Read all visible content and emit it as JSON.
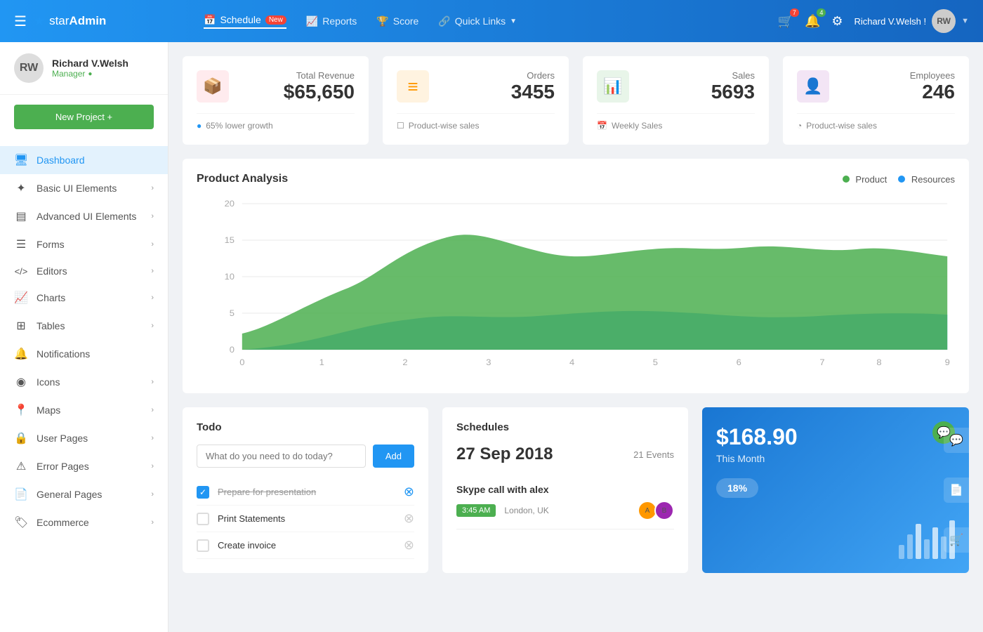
{
  "brand": {
    "name_part1": "star",
    "name_part2": "Admin"
  },
  "topnav": {
    "hamburger": "☰",
    "links": [
      {
        "label": "Schedule",
        "badge": "New",
        "icon": "📅"
      },
      {
        "label": "Reports",
        "icon": "📈"
      },
      {
        "label": "Score",
        "icon": "🏆"
      },
      {
        "label": "Quick Links",
        "icon": "🔗",
        "has_arrow": true
      }
    ],
    "notifications_count": "7",
    "alerts_count": "4",
    "user_name": "Richard V.Welsh !",
    "user_initials": "RW"
  },
  "sidebar": {
    "user_name": "Richard V.Welsh",
    "user_role": "Manager",
    "new_project_label": "New Project +",
    "items": [
      {
        "id": "dashboard",
        "label": "Dashboard",
        "icon": "🖥",
        "active": true,
        "has_arrow": false
      },
      {
        "id": "basic-ui",
        "label": "Basic UI Elements",
        "icon": "✦",
        "has_arrow": true
      },
      {
        "id": "advanced-ui",
        "label": "Advanced UI Elements",
        "icon": "▤",
        "has_arrow": true
      },
      {
        "id": "forms",
        "label": "Forms",
        "icon": "☰",
        "has_arrow": true
      },
      {
        "id": "editors",
        "label": "Editors",
        "icon": "<>",
        "has_arrow": true
      },
      {
        "id": "charts",
        "label": "Charts",
        "icon": "📈",
        "has_arrow": true
      },
      {
        "id": "tables",
        "label": "Tables",
        "icon": "⊞",
        "has_arrow": true
      },
      {
        "id": "notifications",
        "label": "Notifications",
        "icon": "🔔",
        "has_arrow": false
      },
      {
        "id": "icons",
        "label": "Icons",
        "icon": "◉",
        "has_arrow": true
      },
      {
        "id": "maps",
        "label": "Maps",
        "icon": "📍",
        "has_arrow": true
      },
      {
        "id": "user-pages",
        "label": "User Pages",
        "icon": "🔒",
        "has_arrow": true
      },
      {
        "id": "error-pages",
        "label": "Error Pages",
        "icon": "⚠",
        "has_arrow": true
      },
      {
        "id": "general-pages",
        "label": "General Pages",
        "icon": "📄",
        "has_arrow": true
      },
      {
        "id": "ecommerce",
        "label": "Ecommerce",
        "icon": "🏷",
        "has_arrow": true
      }
    ]
  },
  "stats": [
    {
      "id": "revenue",
      "icon": "📦",
      "icon_class": "red",
      "label": "Total Revenue",
      "value": "$65,650",
      "footer_icon": "●",
      "footer_text": "65% lower growth"
    },
    {
      "id": "orders",
      "icon": "≡",
      "icon_class": "orange",
      "label": "Orders",
      "value": "3455",
      "footer_icon": "☐",
      "footer_text": "Product-wise sales"
    },
    {
      "id": "sales",
      "icon": "📊",
      "icon_class": "green",
      "label": "Sales",
      "value": "5693",
      "footer_icon": "📅",
      "footer_text": "Weekly Sales"
    },
    {
      "id": "employees",
      "icon": "👤",
      "icon_class": "purple",
      "label": "Employees",
      "value": "246",
      "footer_icon": "◔",
      "footer_text": "Product-wise sales"
    }
  ],
  "chart": {
    "title": "Product Analysis",
    "legend_product": "Product",
    "legend_resources": "Resources",
    "y_labels": [
      "20",
      "15",
      "10",
      "5",
      "0"
    ],
    "x_labels": [
      "0",
      "1",
      "2",
      "3",
      "4",
      "5",
      "6",
      "7",
      "8",
      "9"
    ]
  },
  "todo": {
    "title": "Todo",
    "input_placeholder": "What do you need to do today?",
    "add_label": "Add",
    "items": [
      {
        "text": "Prepare for presentation",
        "done": true
      },
      {
        "text": "Print Statements",
        "done": false
      },
      {
        "text": "Create invoice",
        "done": false
      }
    ]
  },
  "schedule": {
    "title": "Schedules",
    "date": "27 Sep 2018",
    "events_count": "21 Events",
    "events": [
      {
        "title": "Skype call with alex",
        "time": "3:45 AM",
        "location": "London, UK"
      }
    ]
  },
  "revenue_card": {
    "amount": "$168.90",
    "label": "This Month",
    "percent": "18%"
  }
}
